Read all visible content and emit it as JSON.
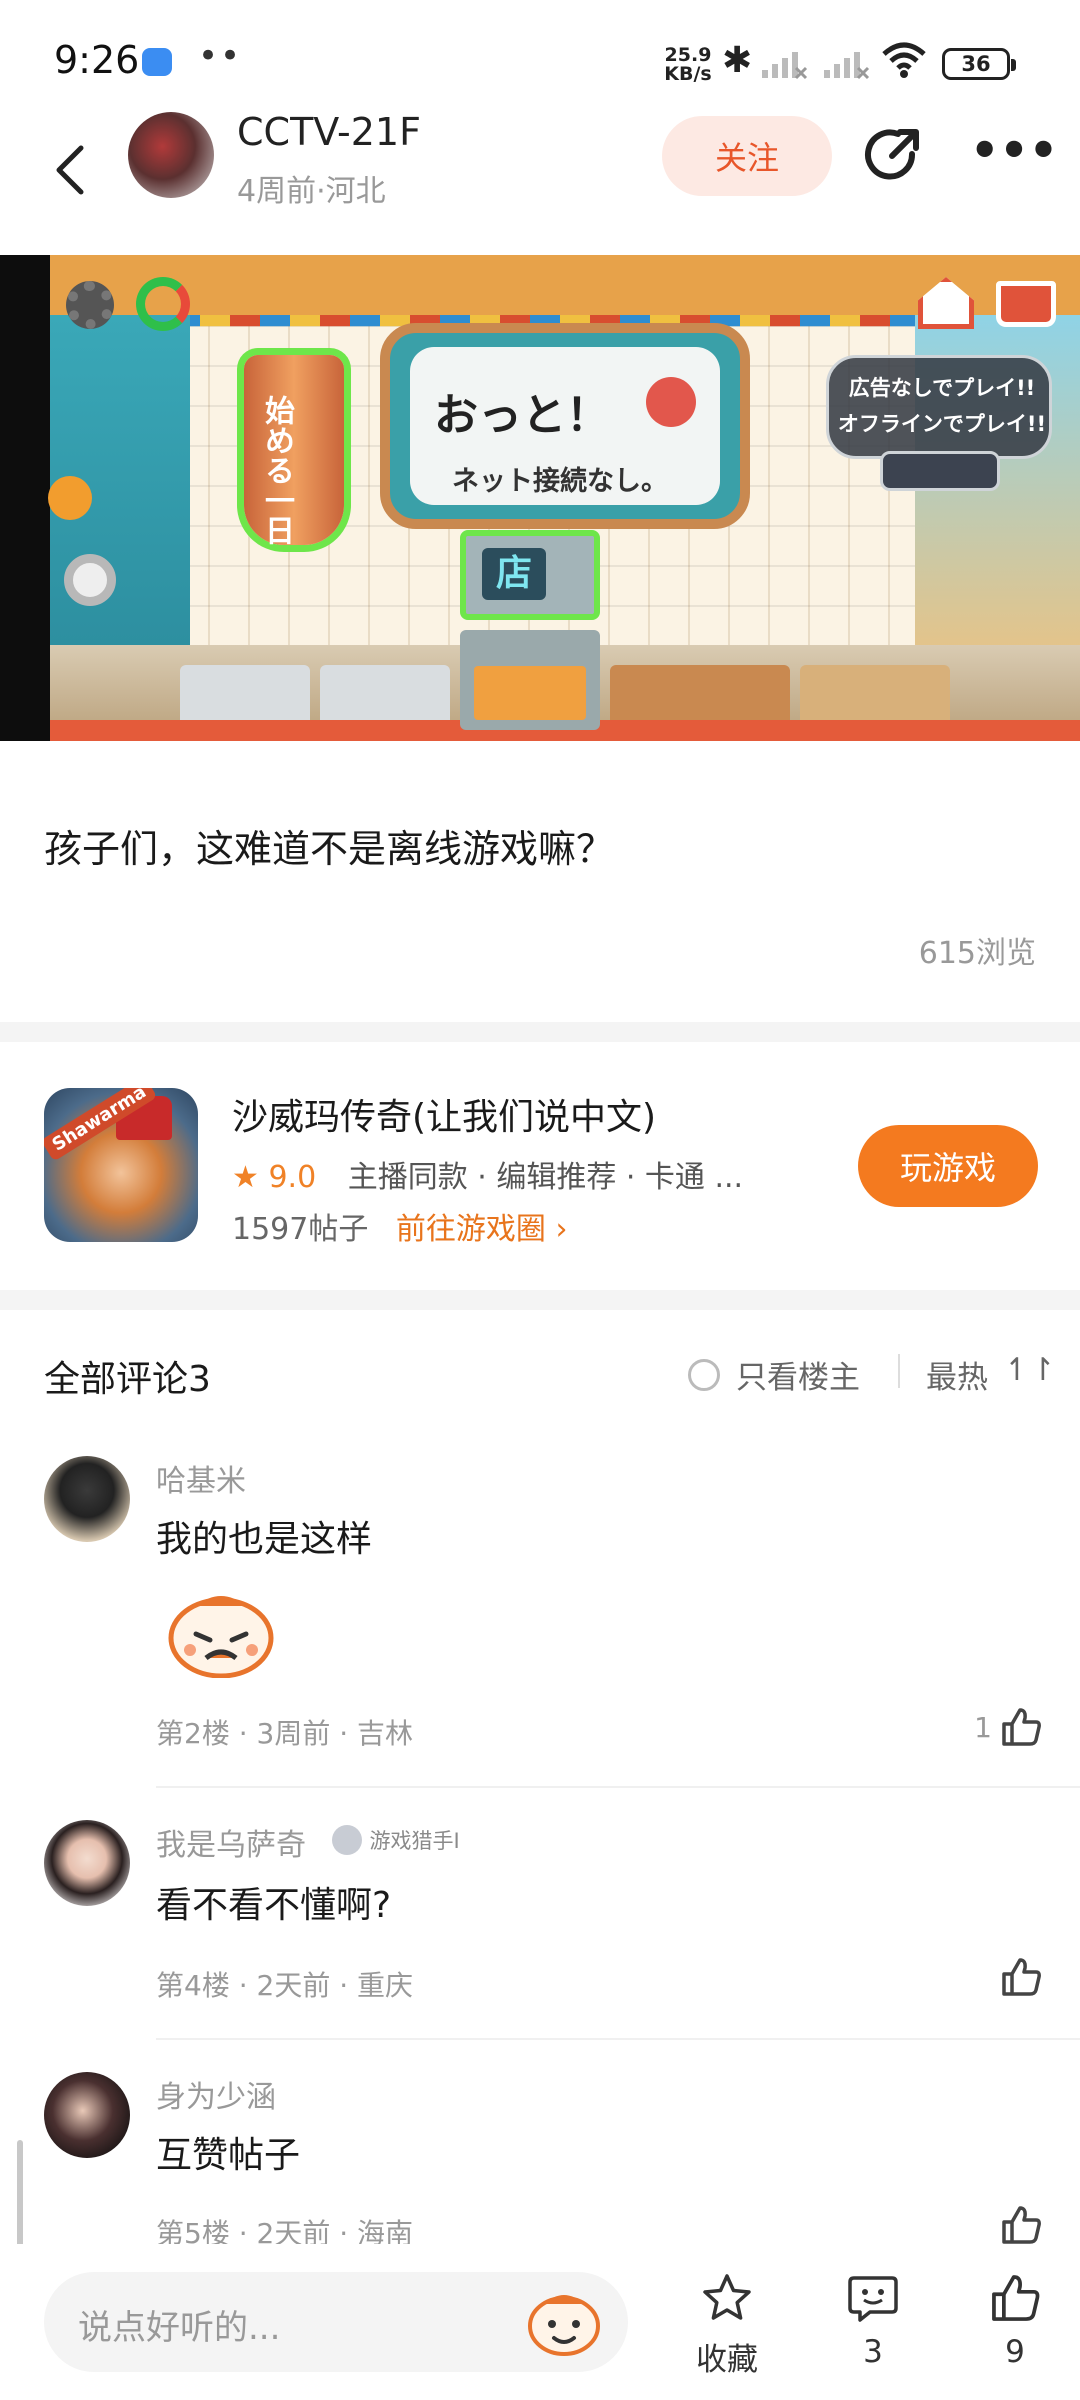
{
  "status_bar": {
    "time": "9:26",
    "net_speed_value": "25.9",
    "net_speed_unit": "KB/s",
    "battery": "36"
  },
  "header": {
    "author_name": "CCTV-21F",
    "author_meta": "4周前·河北",
    "follow_label": "关注"
  },
  "banner": {
    "sign_title": "おっと！",
    "sign_subtitle": "ネット接続なし。",
    "kebab_text": "始める一日",
    "oven_text": "店",
    "ad_line1": "広告なしでプレイ!!",
    "ad_line2": "オフラインでプレイ!!"
  },
  "post": {
    "text": "孩子们，这难道不是离线游戏嘛？",
    "views": "615浏览"
  },
  "game": {
    "icon_label": "Shawarma",
    "title": "沙威玛传奇(让我们说中文)",
    "rating": "9.0",
    "tags": "主播同款 · 编辑推荐 · 卡通 ...",
    "posts": "1597帖子",
    "circle_link": "前往游戏圈",
    "play_label": "玩游戏"
  },
  "comments_header": {
    "title": "全部评论3",
    "owner_only": "只看楼主",
    "sort": "最热"
  },
  "comments": [
    {
      "name": "哈基米",
      "text": "我的也是这样",
      "meta": "第2楼 · 3周前 · 吉林",
      "likes": "1",
      "badge": ""
    },
    {
      "name": "我是乌萨奇",
      "text": "看不看不懂啊?",
      "meta": "第4楼 · 2天前 · 重庆",
      "likes": "",
      "badge": "游戏猎手I"
    },
    {
      "name": "身为少涵",
      "text": "互赞帖子",
      "meta": "第5楼 · 2天前 · 海南",
      "likes": "",
      "badge": ""
    }
  ],
  "bottom_bar": {
    "input_placeholder": "说点好听的...",
    "favorite_label": "收藏",
    "comment_count": "3",
    "like_count": "9"
  },
  "colors": {
    "accent_orange": "#f47a1f",
    "follow_bg": "#fde9e3",
    "follow_text": "#e8562a"
  }
}
